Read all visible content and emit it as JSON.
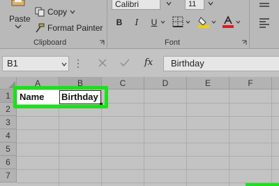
{
  "clipboard": {
    "paste_label": "Paste",
    "copy_label": "Copy",
    "format_painter_label": "Format Painter",
    "group_label": "Clipboard"
  },
  "font": {
    "name": "Calibri",
    "size": "11",
    "group_label": "Font",
    "bold_label": "B",
    "italic_label": "I",
    "underline_label": "U",
    "highlight_color": "#f0d000",
    "font_color": "#d81e1e"
  },
  "formula_bar": {
    "name_box": "B1",
    "fx_label": "fx",
    "content": "Birthday"
  },
  "sheet": {
    "columns": [
      "A",
      "B",
      "C",
      "D",
      "E",
      "F"
    ],
    "rows": [
      "1",
      "2",
      "3",
      "4",
      "5",
      "6",
      "7"
    ],
    "active_cell": "B1",
    "cells": {
      "A1": "Name",
      "B1": "Birthday"
    },
    "selection_color": "#19e219"
  }
}
